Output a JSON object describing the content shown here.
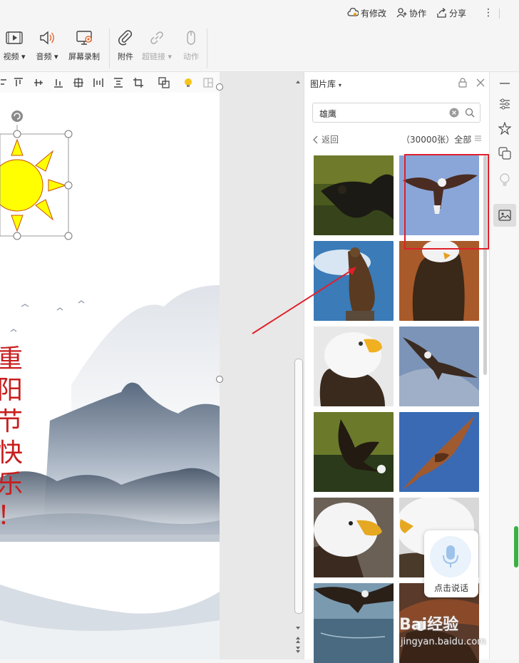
{
  "top": {
    "revise_label": "有修改",
    "collab_label": "协作",
    "share_label": "分享",
    "more_label": "⋮"
  },
  "ribbon": {
    "video_label": "视频",
    "audio_label": "音频",
    "screen_rec_label": "屏幕录制",
    "attach_label": "附件",
    "hyperlink_label": "超链接",
    "action_label": "动作"
  },
  "slide": {
    "text_chars": [
      "重",
      "阳",
      "节",
      "快",
      "乐",
      "！"
    ]
  },
  "panel": {
    "title": "图片库",
    "search_value": "雄鹰",
    "back_label": "返回",
    "count_label": "（30000张）",
    "filter_label": "全部",
    "thumbnails": [
      "eagle-flying-dark",
      "eagle-soaring-sky",
      "eagle-perched-cliff",
      "eagle-portrait-brown",
      "eagle-head-white",
      "eagle-gliding-blue",
      "eagle-swooping-green",
      "eagle-wings-spread",
      "eagle-head-closeup",
      "eagle-head-side",
      "eagle-over-water",
      "eagle-catching-fish"
    ]
  },
  "voice": {
    "label": "点击说话"
  },
  "watermark": {
    "line1": "Bai经验",
    "line2": "jingyan.baidu.com"
  },
  "colors": {
    "highlight": "#e0202a",
    "sun": "#ffff00",
    "sun_stroke": "#c85000",
    "title_red": "#c81e1e"
  }
}
